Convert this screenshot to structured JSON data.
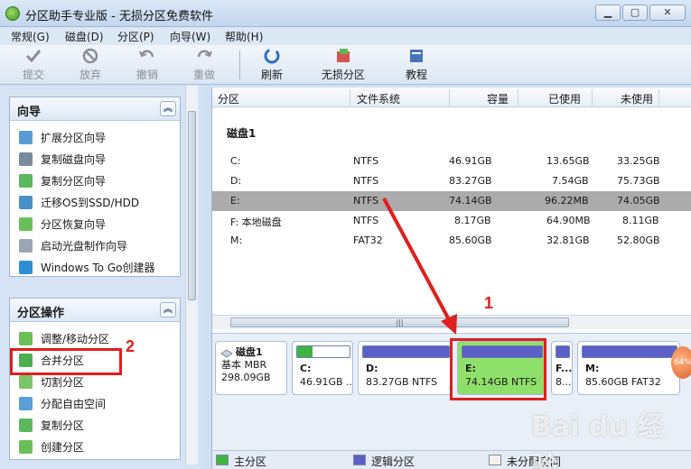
{
  "window": {
    "title": "分区助手专业版 - 无损分区免费软件"
  },
  "menu": [
    "常规(G)",
    "磁盘(D)",
    "分区(P)",
    "向导(W)",
    "帮助(H)"
  ],
  "toolbar": {
    "commit": "提交",
    "discard": "放弃",
    "undo": "撤销",
    "redo": "重做",
    "refresh": "刷新",
    "lossless": "无损分区",
    "tutorial": "教程"
  },
  "wizard": {
    "title": "向导",
    "items": [
      "扩展分区向导",
      "复制磁盘向导",
      "复制分区向导",
      "迁移OS到SSD/HDD",
      "分区恢复向导",
      "启动光盘制作向导",
      "Windows To Go创建器"
    ]
  },
  "operations": {
    "title": "分区操作",
    "items": [
      "调整/移动分区",
      "合并分区",
      "切割分区",
      "分配自由空间",
      "复制分区",
      "创建分区"
    ]
  },
  "columns": {
    "partition": "分区",
    "fs": "文件系统",
    "capacity": "容量",
    "used": "已使用",
    "unused": "未使用"
  },
  "disk": {
    "label": "磁盘1",
    "type": "基本 MBR",
    "size": "298.09GB"
  },
  "partitions": [
    {
      "name": "C:",
      "fs": "NTFS",
      "capacity": "46.91GB",
      "used": "13.65GB",
      "unused": "33.25GB"
    },
    {
      "name": "D:",
      "fs": "NTFS",
      "capacity": "83.27GB",
      "used": "7.54GB",
      "unused": "75.73GB"
    },
    {
      "name": "E:",
      "fs": "NTFS",
      "capacity": "74.14GB",
      "used": "96.22MB",
      "unused": "74.05GB"
    },
    {
      "name": "F: 本地磁盘",
      "fs": "NTFS",
      "capacity": "8.17GB",
      "used": "64.90MB",
      "unused": "8.11GB"
    },
    {
      "name": "M:",
      "fs": "FAT32",
      "capacity": "85.60GB",
      "used": "32.81GB",
      "unused": "52.80GB"
    }
  ],
  "diskmap": {
    "c": {
      "name": "C:",
      "info": "46.91GB ..."
    },
    "d": {
      "name": "D:",
      "info": "83.27GB NTFS"
    },
    "e": {
      "name": "E:",
      "info": "74.14GB NTFS"
    },
    "f": {
      "name": "F...",
      "info": "8..."
    },
    "m": {
      "name": "M:",
      "info": "85.60GB FAT32"
    }
  },
  "legend": {
    "primary": "主分区",
    "logical": "逻辑分区",
    "unallocated": "未分配空间"
  },
  "annotations": {
    "one": "1",
    "two": "2"
  },
  "watermark": "Bai du 经验",
  "orb": "64%",
  "colors": {
    "primary": "#3fb53f",
    "logical": "#5b5fc7",
    "selected": "#8fe06a",
    "highlight": "#e01e1e"
  }
}
